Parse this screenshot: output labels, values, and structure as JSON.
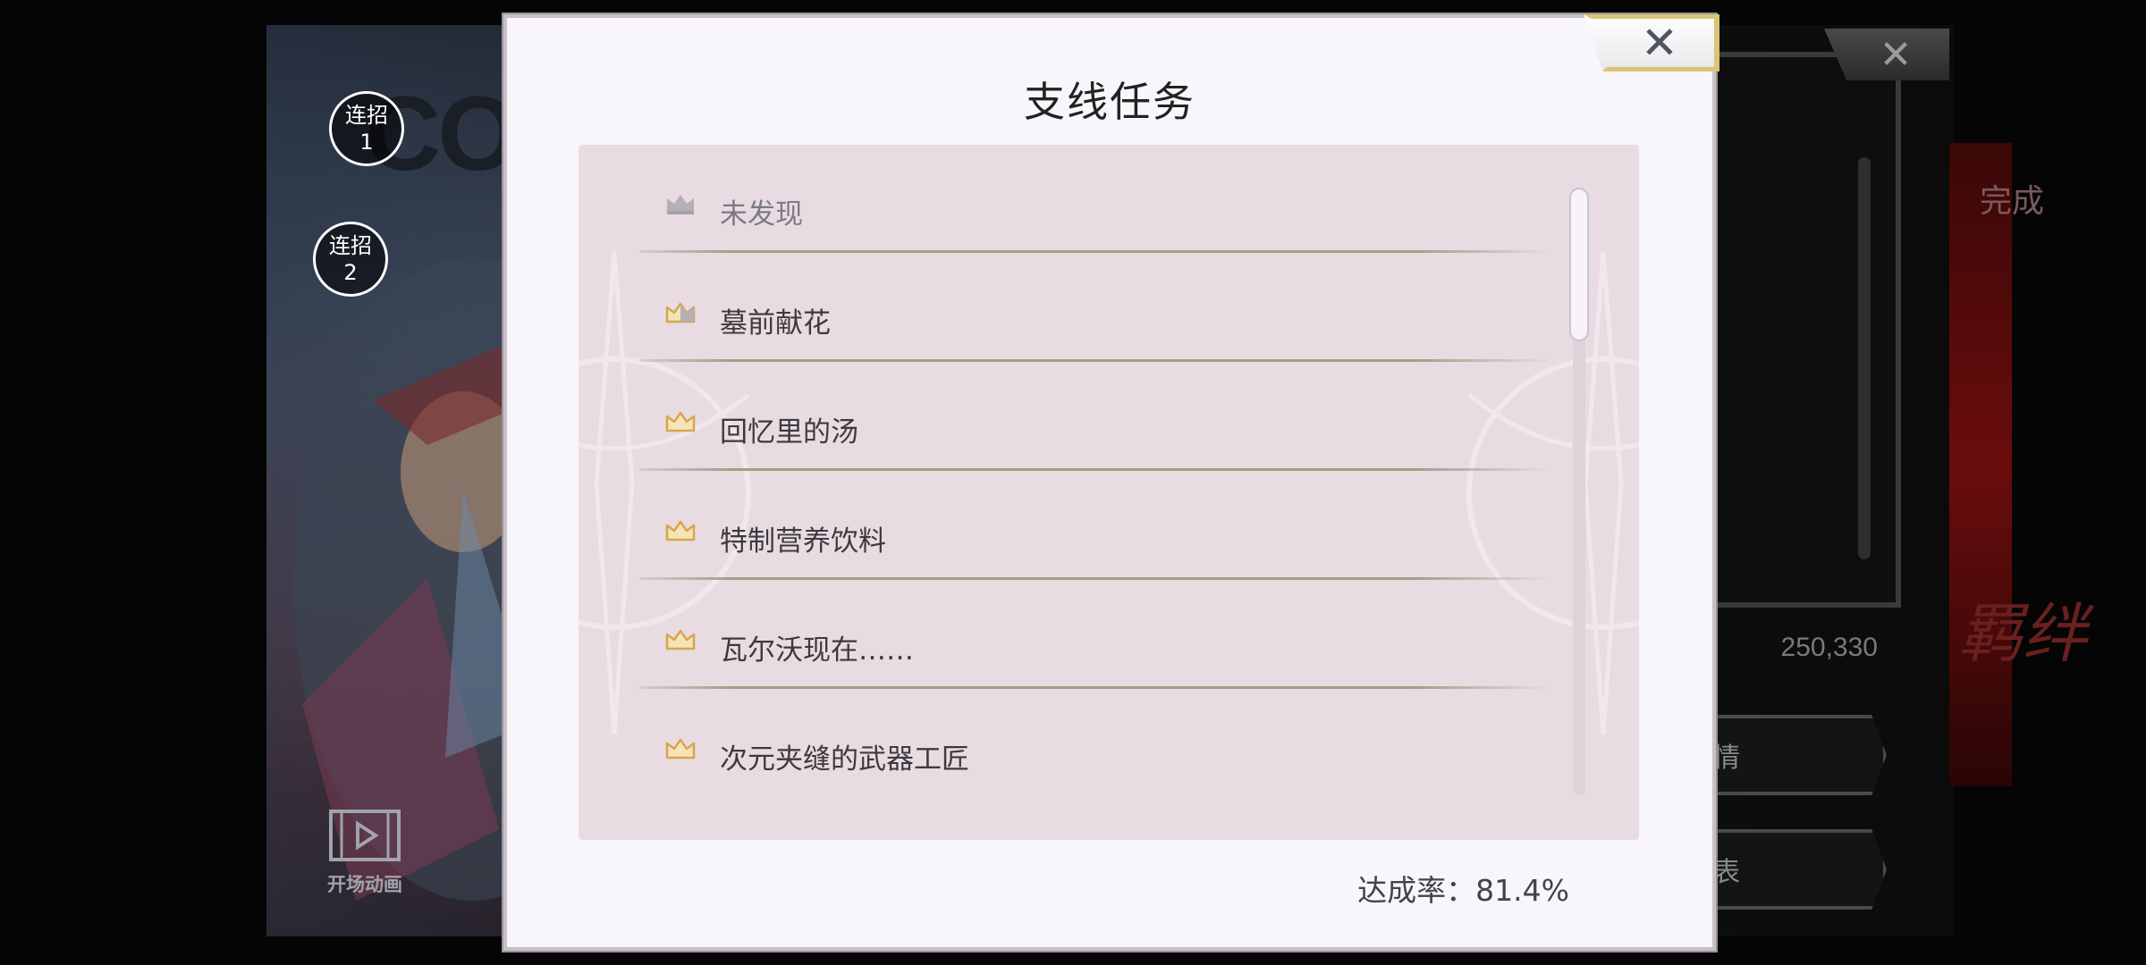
{
  "background": {
    "combo_buttons": [
      {
        "line1": "连招",
        "line2": "1"
      },
      {
        "line1": "连招",
        "line2": "2"
      }
    ],
    "opening_animation_label": "开场动画",
    "logo_text": "COMP DRI",
    "score": "250,330",
    "right_done_label": "完成",
    "right_button_1": "情",
    "right_button_2": "表",
    "right_red_text": "羁绊",
    "close_icon": "close-icon"
  },
  "modal": {
    "title": "支线任务",
    "close_label": "✕",
    "quests": [
      {
        "title": "未发现",
        "status": "undiscovered",
        "icon": "crown-icon"
      },
      {
        "title": "墓前献花",
        "status": "partial",
        "icon": "crown-icon"
      },
      {
        "title": "回忆里的汤",
        "status": "complete",
        "icon": "crown-icon"
      },
      {
        "title": "特制营养饮料",
        "status": "complete",
        "icon": "crown-icon"
      },
      {
        "title": "瓦尔沃现在……",
        "status": "complete",
        "icon": "crown-icon"
      },
      {
        "title": "次元夹缝的武器工匠",
        "status": "complete",
        "icon": "crown-icon"
      }
    ],
    "scroll_position": 0.0,
    "completion_rate": "达成率：81.4%",
    "colors": {
      "crown_gold": "#d8a64c",
      "crown_gray": "#b4b0b6",
      "panel": "#e8dce2",
      "accent_border": "#d9c577"
    }
  }
}
